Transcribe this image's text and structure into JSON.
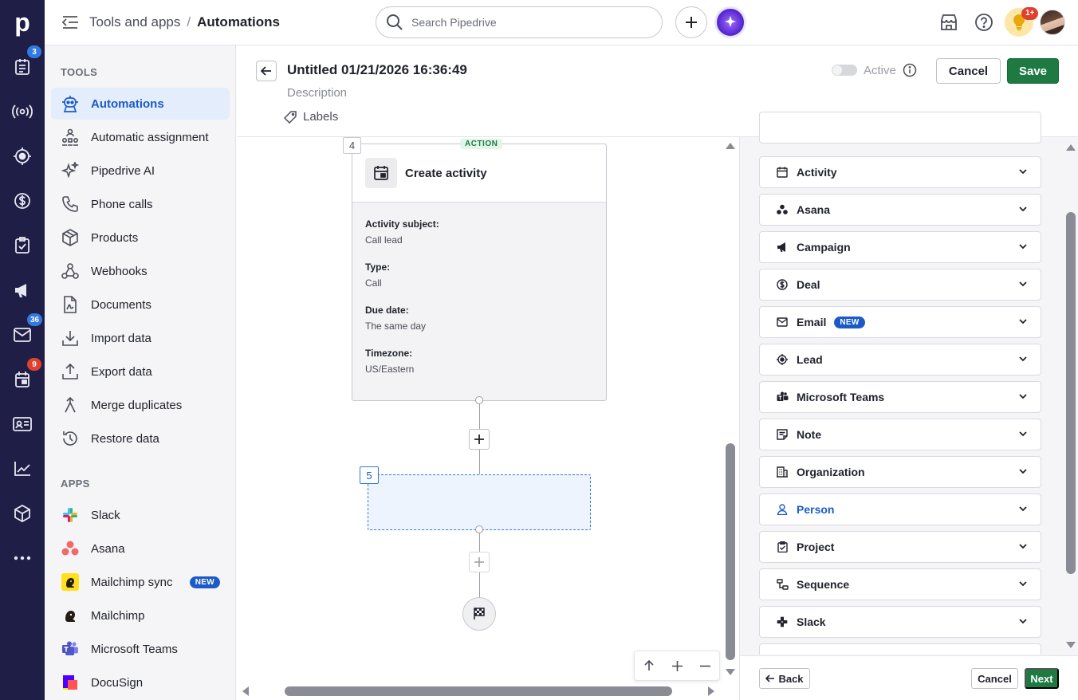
{
  "rail": {
    "badges": {
      "activities_count": "3",
      "mail_count": "36",
      "calendar_count": "9"
    }
  },
  "topbar": {
    "breadcrumb_parent": "Tools and apps",
    "breadcrumb_sep": "/",
    "breadcrumb_current": "Automations",
    "search_placeholder": "Search Pipedrive",
    "notification_badge": "1+"
  },
  "sidenav": {
    "tools_title": "TOOLS",
    "tools": [
      {
        "label": "Automations",
        "icon": "robot-icon",
        "active": true
      },
      {
        "label": "Automatic assignment",
        "icon": "assignment-icon"
      },
      {
        "label": "Pipedrive AI",
        "icon": "sparkle-icon"
      },
      {
        "label": "Phone calls",
        "icon": "phone-icon"
      },
      {
        "label": "Products",
        "icon": "box-icon"
      },
      {
        "label": "Webhooks",
        "icon": "webhook-icon"
      },
      {
        "label": "Documents",
        "icon": "document-icon"
      },
      {
        "label": "Import data",
        "icon": "download-icon"
      },
      {
        "label": "Export data",
        "icon": "upload-icon"
      },
      {
        "label": "Merge duplicates",
        "icon": "merge-icon"
      },
      {
        "label": "Restore data",
        "icon": "restore-icon"
      }
    ],
    "apps_title": "APPS",
    "apps": [
      {
        "label": "Slack",
        "icon": "slack-icon"
      },
      {
        "label": "Asana",
        "icon": "asana-icon"
      },
      {
        "label": "Mailchimp sync",
        "icon": "mailchimp-icon",
        "badge": "NEW"
      },
      {
        "label": "Mailchimp",
        "icon": "mailchimp-icon"
      },
      {
        "label": "Microsoft Teams",
        "icon": "teams-icon"
      },
      {
        "label": "DocuSign",
        "icon": "docusign-icon"
      }
    ]
  },
  "editor": {
    "title": "Untitled 01/21/2026 16:36:49",
    "description_placeholder": "Description",
    "labels": "Labels",
    "active_label": "Active",
    "active_on": false,
    "cancel": "Cancel",
    "save": "Save"
  },
  "canvas": {
    "step_number": "4",
    "step_tag": "ACTION",
    "card_title": "Create activity",
    "fields": [
      {
        "key": "Activity subject:",
        "value": "Call lead"
      },
      {
        "key": "Type:",
        "value": "Call"
      },
      {
        "key": "Due date:",
        "value": "The same day"
      },
      {
        "key": "Timezone:",
        "value": "US/Eastern"
      }
    ],
    "placeholder_step_number": "5"
  },
  "right_panel": {
    "categories": [
      {
        "label": "Activity",
        "icon": "calendar-icon"
      },
      {
        "label": "Asana",
        "icon": "asana-icon"
      },
      {
        "label": "Campaign",
        "icon": "megaphone-icon"
      },
      {
        "label": "Deal",
        "icon": "dollar-icon"
      },
      {
        "label": "Email",
        "icon": "mail-icon",
        "badge": "NEW"
      },
      {
        "label": "Lead",
        "icon": "target-icon"
      },
      {
        "label": "Microsoft Teams",
        "icon": "teams-icon"
      },
      {
        "label": "Note",
        "icon": "note-icon"
      },
      {
        "label": "Organization",
        "icon": "building-icon"
      },
      {
        "label": "Person",
        "icon": "person-icon",
        "selected": true
      },
      {
        "label": "Project",
        "icon": "project-icon"
      },
      {
        "label": "Sequence",
        "icon": "sequence-icon"
      },
      {
        "label": "Slack",
        "icon": "slack-icon"
      }
    ],
    "back": "Back",
    "cancel": "Cancel",
    "next": "Next"
  },
  "colors": {
    "rail_bg": "#1f1e47",
    "accent_blue": "#1a5bc7",
    "save_green": "#1e7a42",
    "badge_red": "#e0412e"
  }
}
